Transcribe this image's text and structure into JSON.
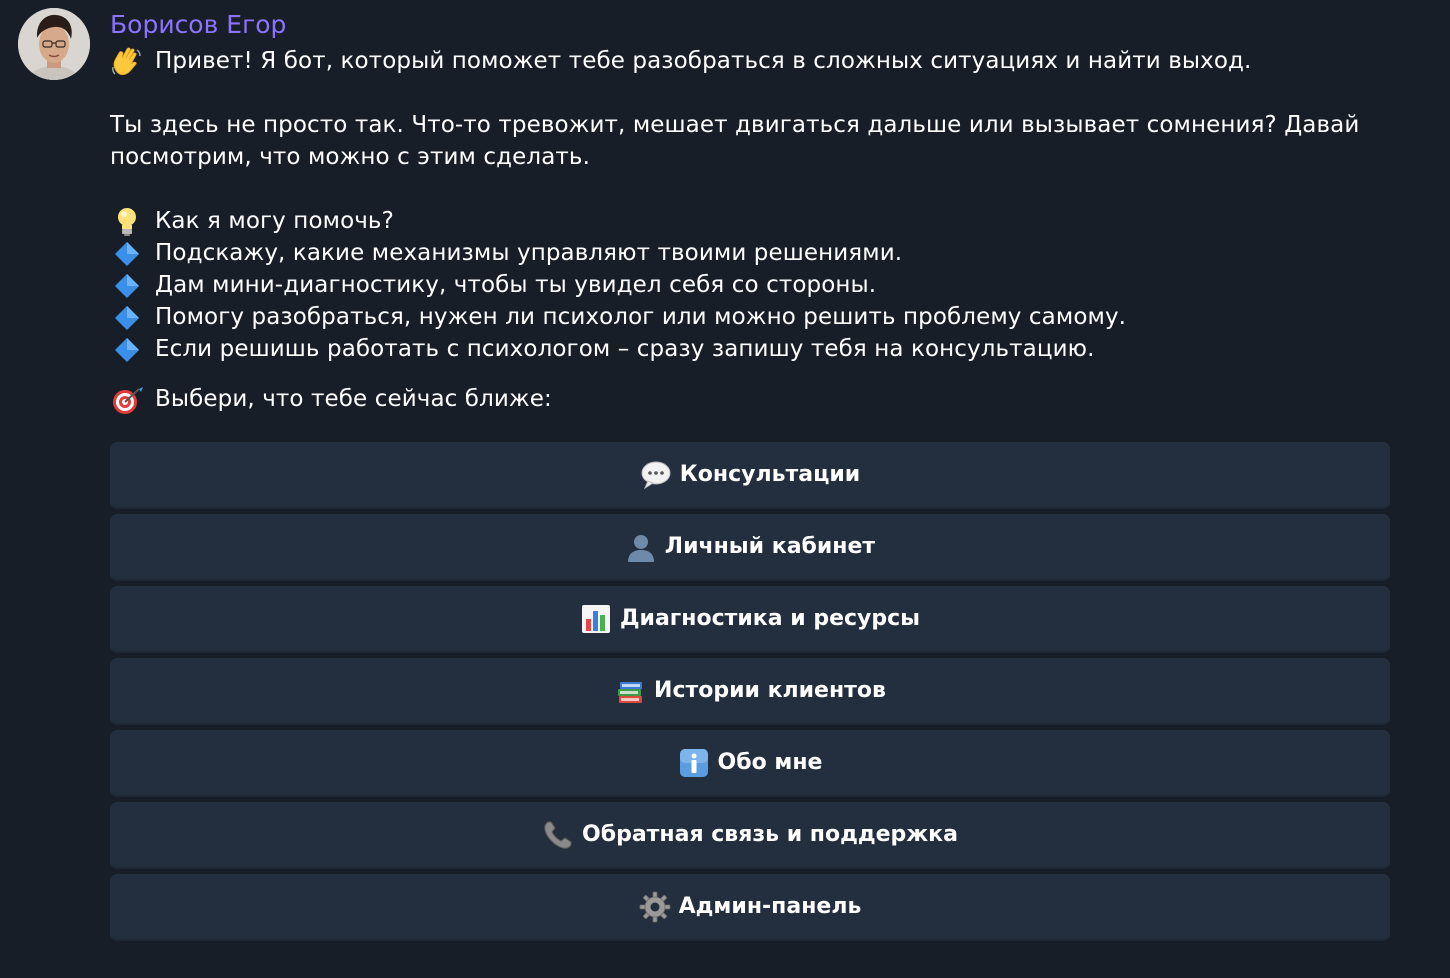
{
  "chat": {
    "sender_name": "Борисов Егор",
    "avatar_icon": "person-avatar",
    "colors": {
      "background": "#181e27",
      "sender_name": "#8b73ff",
      "button_bg": "#232e3e",
      "text": "#ffffff"
    }
  },
  "message": {
    "greeting": "Привет! Я бот, который поможет тебе разобраться в сложных ситуациях и найти выход.",
    "intro_line1": "Ты здесь не просто так. Что-то тревожит, мешает двигаться дальше или вызывает сомнения? Давай",
    "intro_line2": "посмотрим, что можно с этим сделать.",
    "help_title": "Как я могу помочь?",
    "bullets": [
      "Подскажу, какие механизмы управляют твоими решениями.",
      "Дам мини-диагностику, чтобы ты увидел себя со стороны.",
      "Помогу разобраться, нужен ли психолог или можно решить проблему самому.",
      "Если решишь работать с психологом – сразу запишу тебя на консультацию."
    ],
    "choose_prompt": "Выбери, что тебе сейчас ближе:"
  },
  "keyboard": {
    "buttons": [
      {
        "label": "Консультации",
        "icon": "speech-bubble-icon"
      },
      {
        "label": "Личный кабинет",
        "icon": "user-silhouette-icon"
      },
      {
        "label": "Диагностика и ресурсы",
        "icon": "bar-chart-icon"
      },
      {
        "label": "Истории клиентов",
        "icon": "books-icon"
      },
      {
        "label": "Обо мне",
        "icon": "info-icon"
      },
      {
        "label": "Обратная связь и поддержка",
        "icon": "phone-icon"
      },
      {
        "label": "Админ-панель",
        "icon": "gear-icon"
      }
    ]
  }
}
